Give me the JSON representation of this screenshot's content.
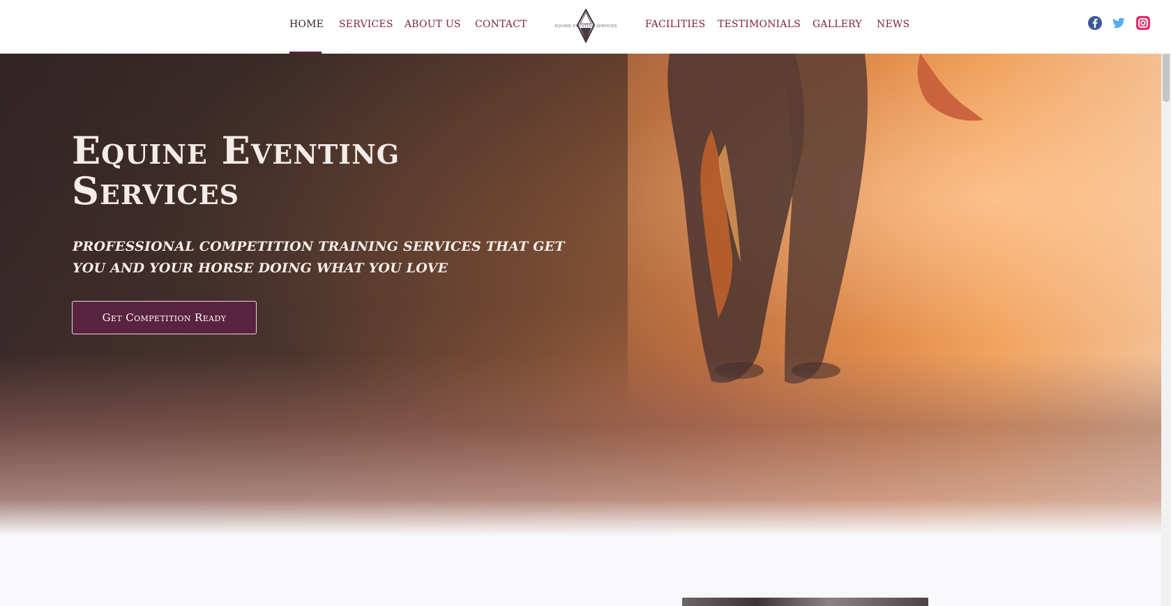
{
  "nav": {
    "left_items": [
      {
        "label": "HOME",
        "active": true
      },
      {
        "label": "SERVICES"
      },
      {
        "label": "ABOUT US"
      },
      {
        "label": "CONTACT"
      }
    ],
    "right_items": [
      {
        "label": "FACILITIES"
      },
      {
        "label": "TESTIMONIALS"
      },
      {
        "label": "GALLERY"
      },
      {
        "label": "NEWS"
      }
    ],
    "logo_text": "EQUINE EVENTING SERVICES"
  },
  "social": [
    "facebook-icon",
    "twitter-icon",
    "instagram-icon"
  ],
  "colors": {
    "nav_text": "#7a1f3d",
    "button_bg": "#5a2340",
    "facebook": "#3b5998",
    "twitter": "#55acee",
    "instagram": "#e1306c"
  },
  "hero": {
    "title": "Equine Eventing Services",
    "subtitle": "PROFESSIONAL COMPETITION TRAINING SERVICES THAT GET YOU AND YOUR HORSE DOING WHAT YOU LOVE",
    "cta_label": "Get Competition Ready"
  }
}
